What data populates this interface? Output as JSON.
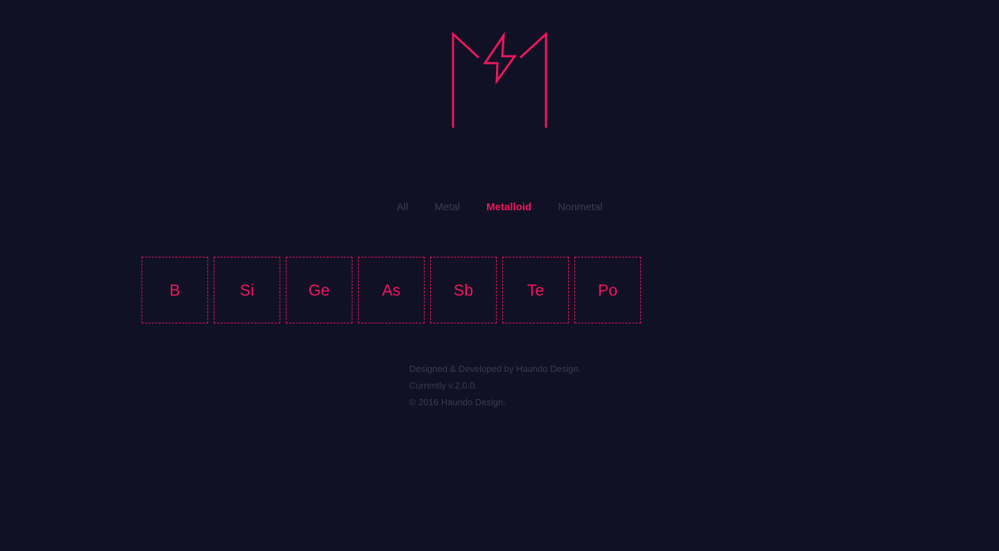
{
  "colors": {
    "background": "#111125",
    "accent": "#f0175d",
    "muted": "#3c3d52"
  },
  "logo": {
    "icon": "lightning-m-logo-icon"
  },
  "filters": {
    "items": [
      {
        "label": "All",
        "active": false
      },
      {
        "label": "Metal",
        "active": false
      },
      {
        "label": "Metalloid",
        "active": true
      },
      {
        "label": "Nonmetal",
        "active": false
      }
    ]
  },
  "elements": {
    "items": [
      {
        "symbol": "B"
      },
      {
        "symbol": "Si"
      },
      {
        "symbol": "Ge"
      },
      {
        "symbol": "As"
      },
      {
        "symbol": "Sb"
      },
      {
        "symbol": "Te"
      },
      {
        "symbol": "Po"
      }
    ]
  },
  "footer": {
    "credit": "Designed & Developed by Haundo Design.",
    "version": "Currently v.2.0.0.",
    "copyright": "© 2016 Haundo Design."
  }
}
